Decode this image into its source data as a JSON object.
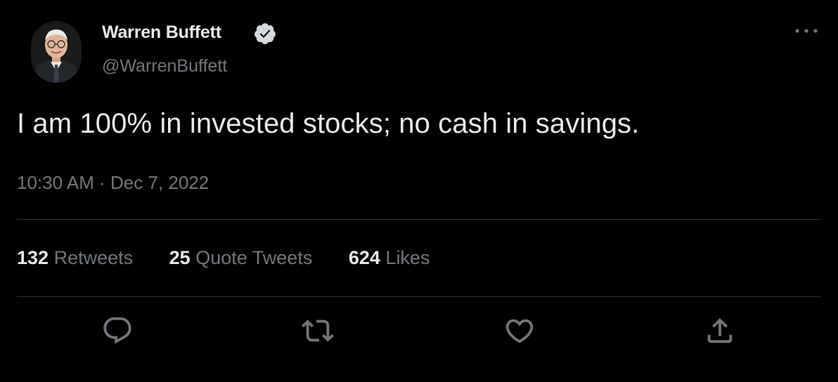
{
  "author": {
    "display_name": "Warren Buffett",
    "handle": "@WarrenBuffett",
    "verified": true
  },
  "tweet": {
    "text": "I am 100% in invested stocks; no cash in savings.",
    "time": "10:30 AM",
    "separator": "·",
    "date": "Dec 7, 2022"
  },
  "stats": {
    "retweets_count": "132",
    "retweets_label": "Retweets",
    "quote_tweets_count": "25",
    "quote_tweets_label": "Quote Tweets",
    "likes_count": "624",
    "likes_label": "Likes"
  },
  "icons": {
    "more": "more-horizontal-icon",
    "verified": "verified-badge-icon",
    "reply": "reply-icon",
    "retweet": "retweet-icon",
    "like": "heart-icon",
    "share": "share-icon"
  },
  "colors": {
    "background": "#000000",
    "primary_text": "#e7e9ea",
    "secondary_text": "#71767b",
    "divider": "#2f3336"
  }
}
